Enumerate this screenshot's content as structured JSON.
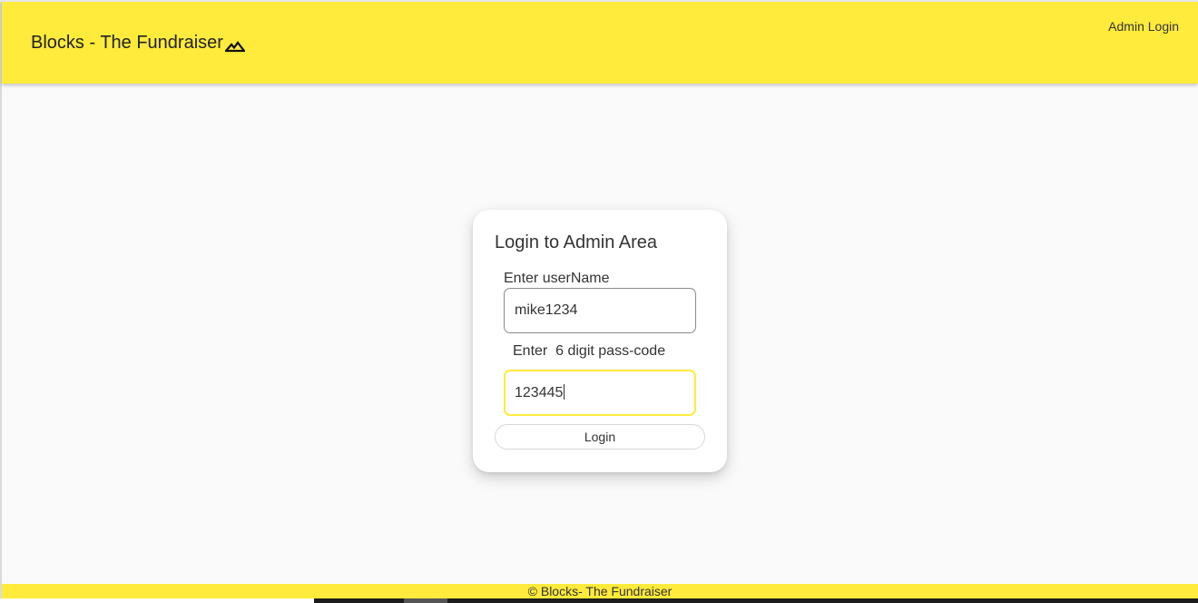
{
  "header": {
    "title": "Blocks - The Fundraiser",
    "brand_icon": "landscape-icon",
    "admin_link": "Admin Login"
  },
  "login_card": {
    "title": "Login to Admin Area",
    "username_label": "Enter userName",
    "username_value": "mike1234",
    "passcode_label": "Enter  6 digit pass-code",
    "passcode_value": "123445",
    "login_button": "Login"
  },
  "footer": {
    "text": "© Blocks- The Fundraiser"
  },
  "colors": {
    "accent": "#ffeb3b",
    "background": "#fafafa"
  }
}
